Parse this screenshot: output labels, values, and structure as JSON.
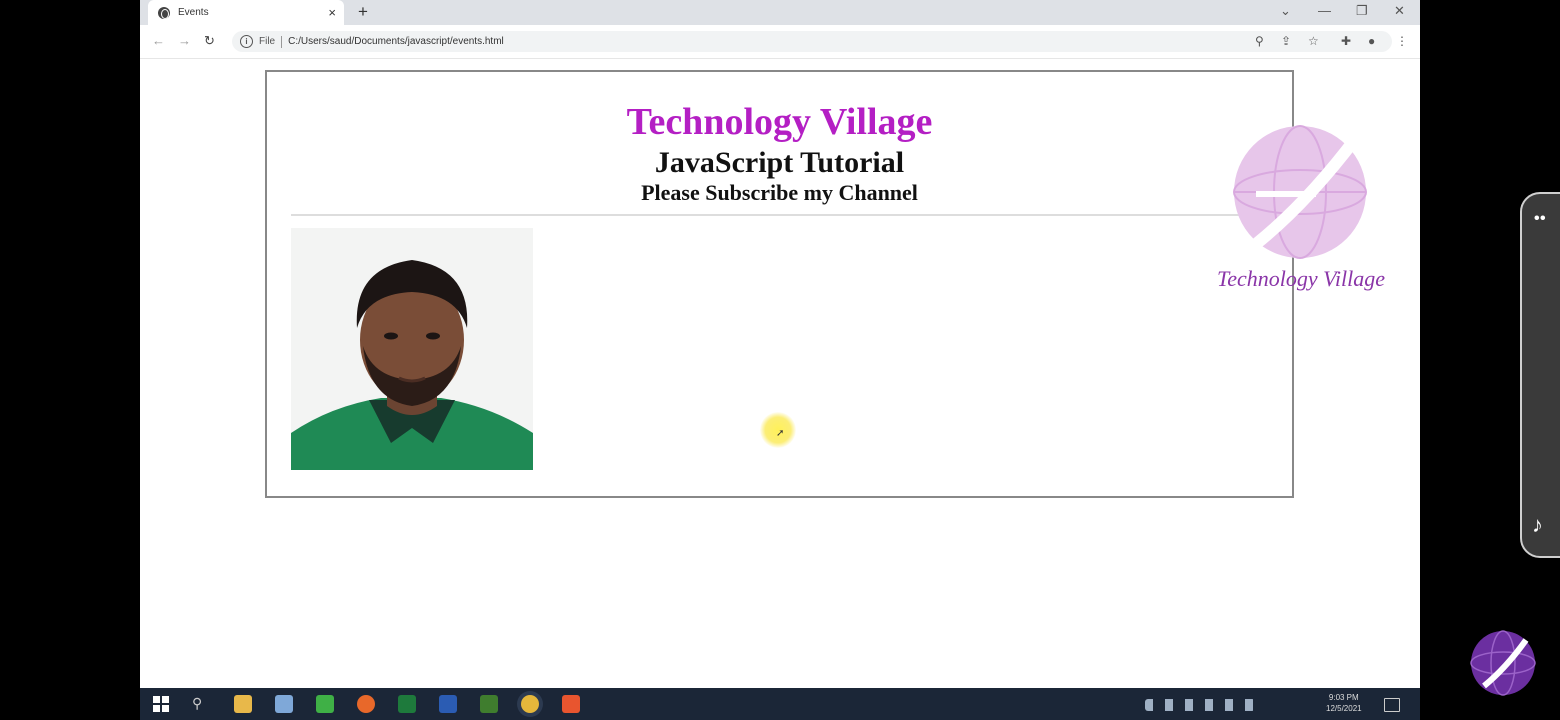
{
  "browser": {
    "tab_title": "Events",
    "file_label": "File",
    "url": "C:/Users/saud/Documents/javascript/events.html",
    "new_tab_symbol": "+",
    "close_symbol": "×"
  },
  "page": {
    "site_title": "Technology Village",
    "tutorial_title": "JavaScript Tutorial",
    "subscribe_text": "Please Subscribe my Channel",
    "logo_text": "Technology Village"
  },
  "taskbar": {
    "time": "9:03 PM",
    "date": "12/5/2021"
  },
  "colors": {
    "title_purple": "#b41fc4",
    "logo_purple": "#8a35a8",
    "taskbar": "#1b2637"
  }
}
